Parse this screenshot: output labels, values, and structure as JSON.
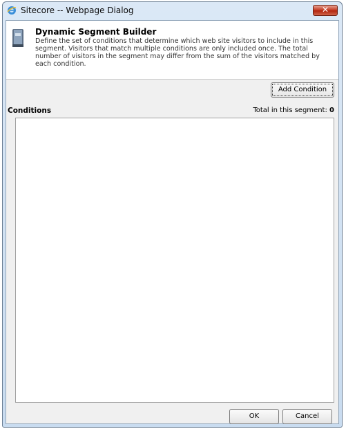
{
  "window": {
    "title": "Sitecore -- Webpage Dialog",
    "close_icon": "close-icon"
  },
  "header": {
    "title": "Dynamic Segment Builder",
    "description": "Define the set of conditions that determine which web site visitors to include in this segment. Visitors that match multiple conditions are only included once. The total number of visitors in the segment may differ from the sum of the visitors matched by each condition."
  },
  "toolbar": {
    "add_condition_label": "Add Condition"
  },
  "conditions": {
    "label": "Conditions",
    "total_label": "Total in this segment:",
    "total_value": "0",
    "items": []
  },
  "footer": {
    "ok_label": "OK",
    "cancel_label": "Cancel"
  },
  "colors": {
    "close_button": "#c7412a",
    "window_frame": "#c9dcf0",
    "client_bg": "#f0f0f0"
  }
}
